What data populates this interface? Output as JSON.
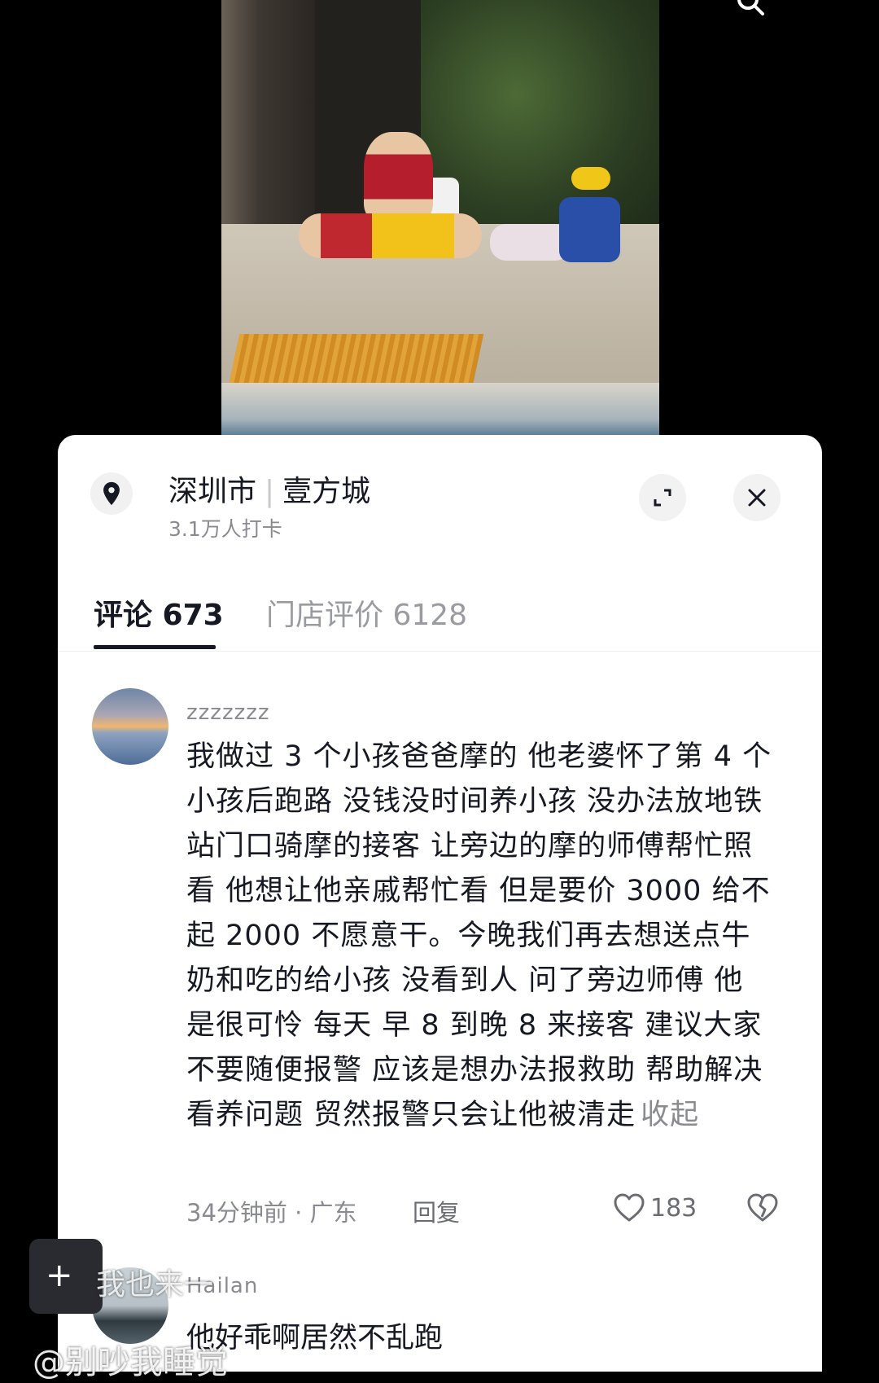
{
  "location": {
    "city": "深圳市",
    "place": "壹方城",
    "checkins": "3.1万人打卡"
  },
  "tabs": [
    {
      "label": "评论 673"
    },
    {
      "label": "门店评价 6128"
    }
  ],
  "comments": [
    {
      "username": "zzzzzzz",
      "text": "我做过 3 个小孩爸爸摩的 他老婆怀了第 4 个小孩后跑路 没钱没时间养小孩 没办法放地铁站门口骑摩的接客 让旁边的摩的师傅帮忙照看 他想让他亲戚帮忙看 但是要价 3000 给不起 2000 不愿意干。今晚我们再去想送点牛奶和吃的给小孩 没看到人 问了旁边师傅 他是很可怜 每天 早 8 到晚 8 来接客  建议大家不要随便报警 应该是想办法报救助 帮助解决看养问题 贸然报警只会让他被清走",
      "collapse": "收起",
      "time_location": "34分钟前 · 广东",
      "reply": "回复",
      "likes": "183"
    },
    {
      "username": "Hailan",
      "text": "他好乖啊居然不乱跑"
    }
  ],
  "overlay": {
    "float_button": "+",
    "mid_text": "我也来一",
    "watermark": "@别吵我睡觉"
  }
}
